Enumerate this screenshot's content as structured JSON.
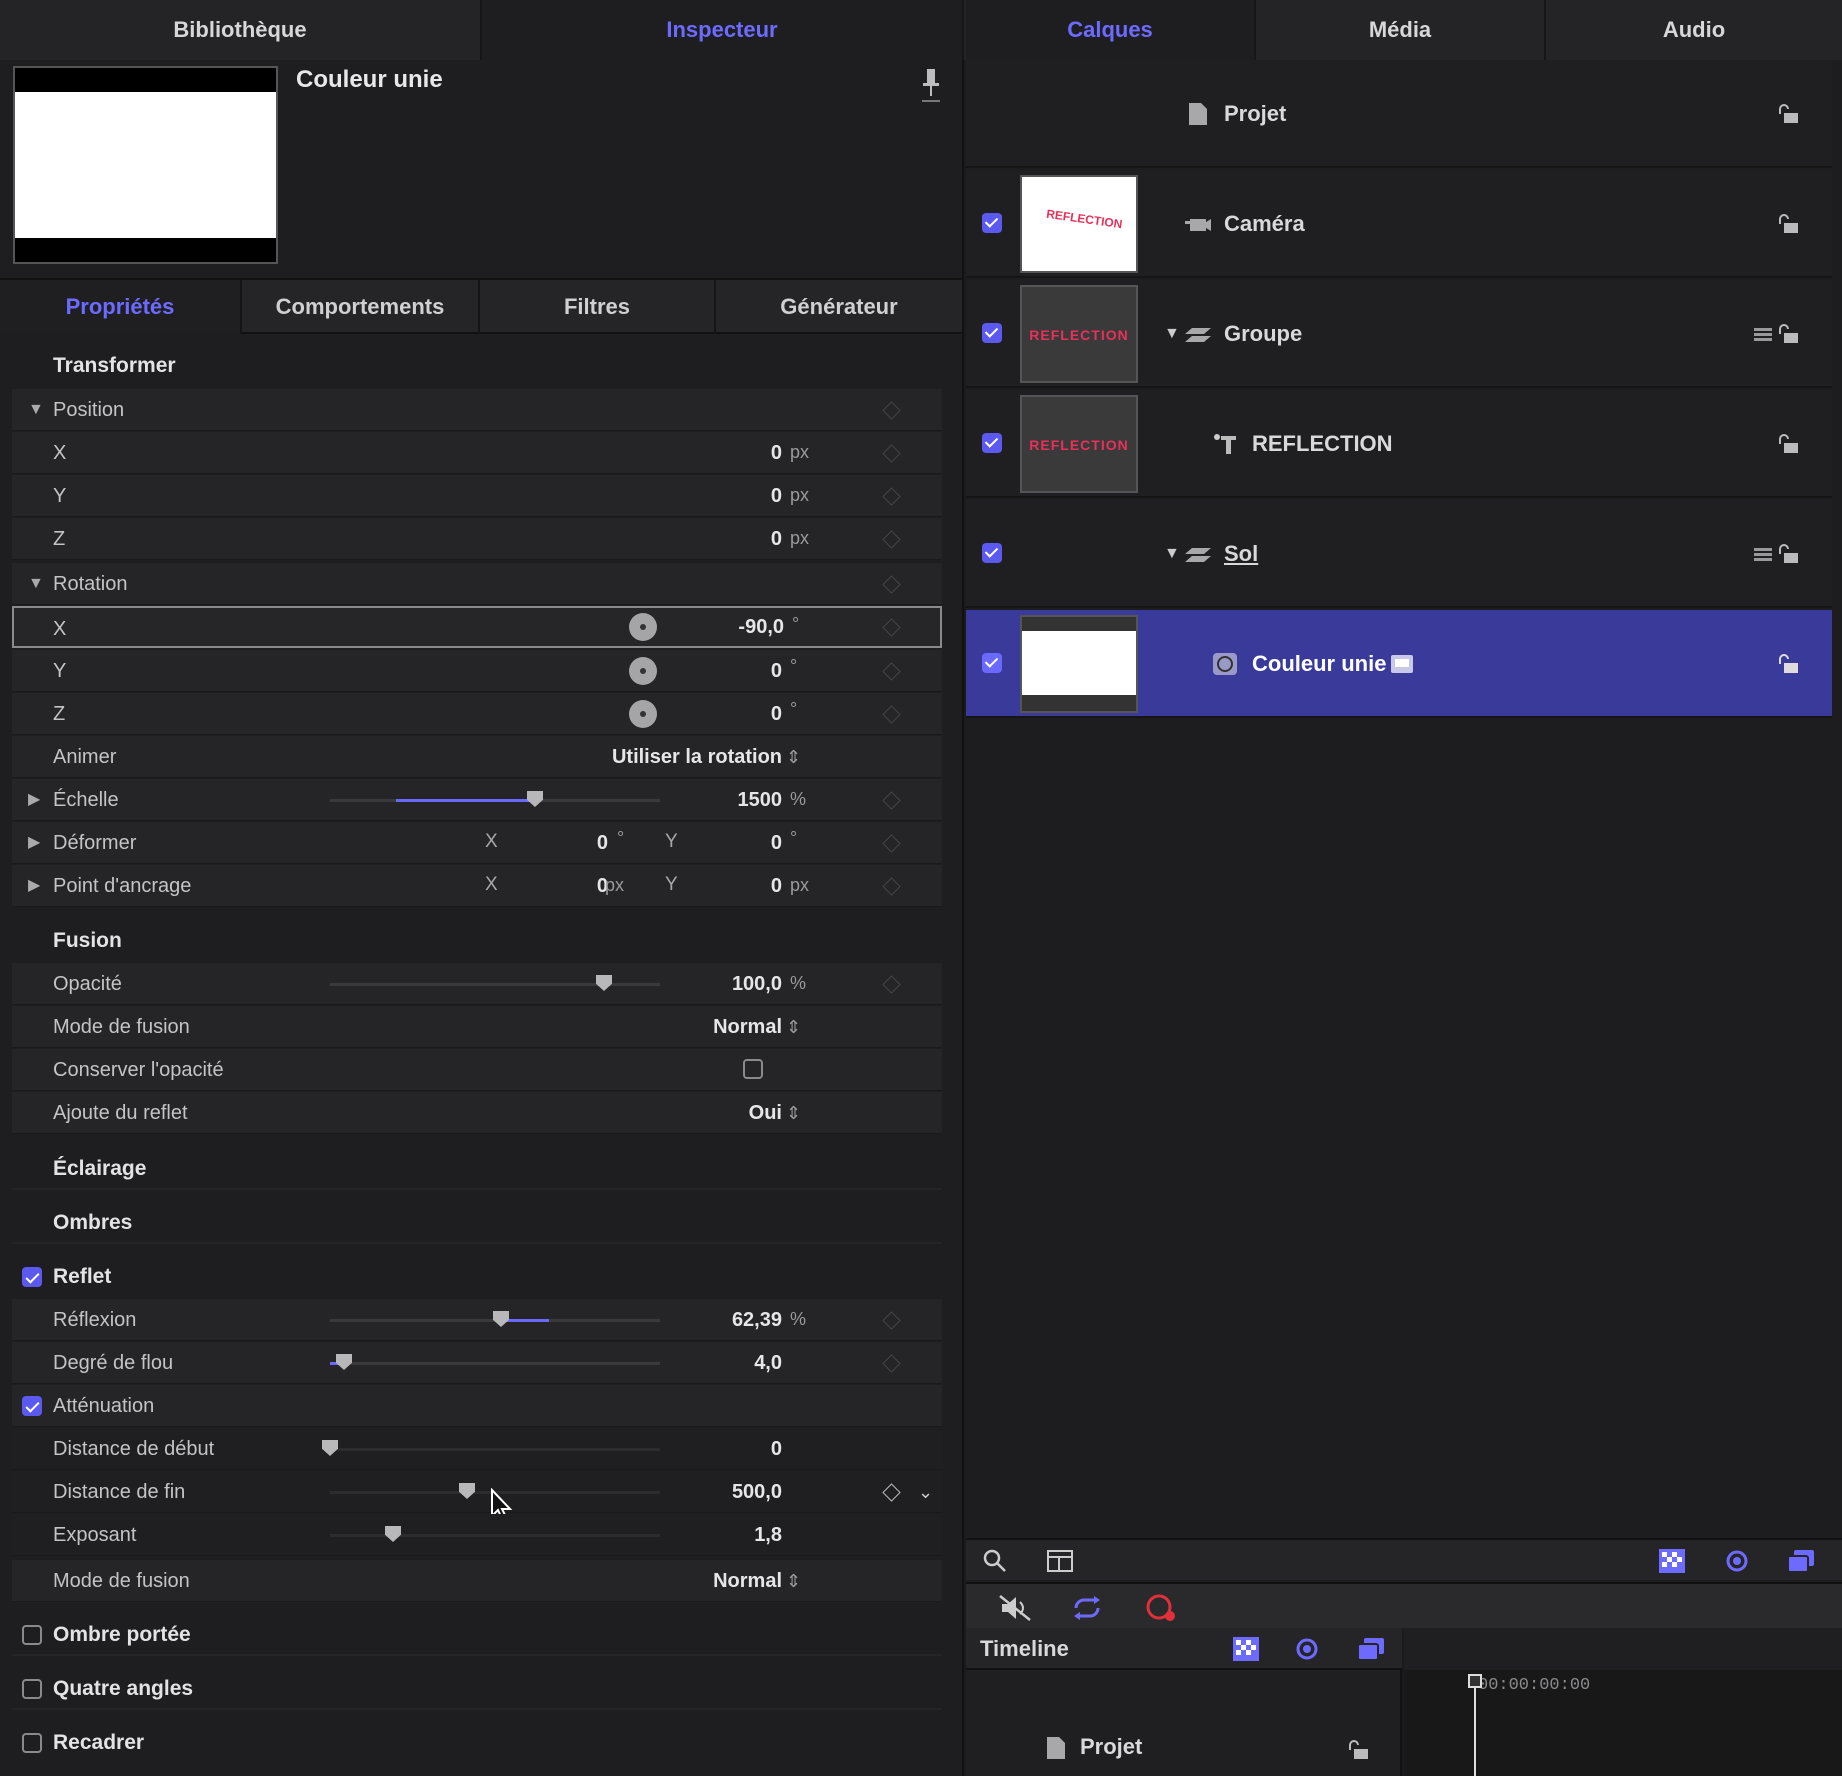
{
  "top_tabs": [
    "Bibliothèque",
    "Inspecteur",
    "Calques",
    "Média",
    "Audio"
  ],
  "inspector": {
    "title": "Couleur unie"
  },
  "subtabs": [
    "Propriétés",
    "Comportements",
    "Filtres",
    "Générateur"
  ],
  "transform": {
    "heading": "Transformer",
    "position": {
      "label": "Position",
      "x": "0",
      "y": "0",
      "z": "0",
      "unit": "px",
      "x_label": "X",
      "y_label": "Y",
      "z_label": "Z"
    },
    "rotation": {
      "label": "Rotation",
      "x": "-90,0",
      "y": "0",
      "z": "0",
      "unit": "°",
      "x_label": "X",
      "y_label": "Y",
      "z_label": "Z"
    },
    "animate": {
      "label": "Animer",
      "value": "Utiliser la rotation"
    },
    "scale": {
      "label": "Échelle",
      "value": "1500",
      "unit": "%",
      "level": 0.75
    },
    "shear": {
      "label": "Déformer",
      "x_label": "X",
      "x": "0",
      "x_unit": "°",
      "y_label": "Y",
      "y": "0",
      "y_unit": "°"
    },
    "anchor": {
      "label": "Point d'ancrage",
      "x_label": "X",
      "x": "0",
      "x_unit": "px",
      "y_label": "Y",
      "y": "0",
      "y_unit": "px"
    }
  },
  "blend": {
    "heading": "Fusion",
    "opacity": {
      "label": "Opacité",
      "value": "100,0",
      "unit": "%",
      "level": 1.0
    },
    "mode": {
      "label": "Mode de fusion",
      "value": "Normal"
    },
    "preserve": {
      "label": "Conserver l'opacité"
    },
    "reflection": {
      "label": "Ajoute du reflet",
      "value": "Oui"
    }
  },
  "lighting": {
    "heading": "Éclairage"
  },
  "shadows": {
    "heading": "Ombres"
  },
  "reflect": {
    "heading": "Reflet",
    "reflectivity": {
      "label": "Réflexion",
      "value": "62,39",
      "unit": "%",
      "level": 0.6239
    },
    "blur": {
      "label": "Degré de flou",
      "value": "4,0",
      "level": 0.05
    },
    "falloff": {
      "label": "Atténuation"
    },
    "start": {
      "label": "Distance de début",
      "value": "0",
      "level": 0.0
    },
    "end": {
      "label": "Distance de fin",
      "value": "500,0",
      "level": 0.5
    },
    "exponent": {
      "label": "Exposant",
      "value": "1,8",
      "level": 0.23
    },
    "mode": {
      "label": "Mode de fusion",
      "value": "Normal"
    }
  },
  "drop_shadow": {
    "label": "Ombre portée"
  },
  "four_corner": {
    "label": "Quatre angles"
  },
  "crop": {
    "label": "Recadrer"
  },
  "layers": [
    {
      "name": "Projet"
    },
    {
      "name": "Caméra",
      "thumb_text": "REFLECTION"
    },
    {
      "name": "Groupe",
      "thumb_text": "REFLECTION"
    },
    {
      "name": "REFLECTION",
      "thumb_text": "REFLECTION"
    },
    {
      "name": "Sol"
    },
    {
      "name": "Couleur unie"
    }
  ],
  "timeline": {
    "label": "Timeline",
    "timecode": "00:00:00:00",
    "project": "Projet"
  },
  "colors": {
    "accent": "#6d6bff",
    "selection": "#3a3a9a",
    "reflection_text": "#e8315a"
  }
}
